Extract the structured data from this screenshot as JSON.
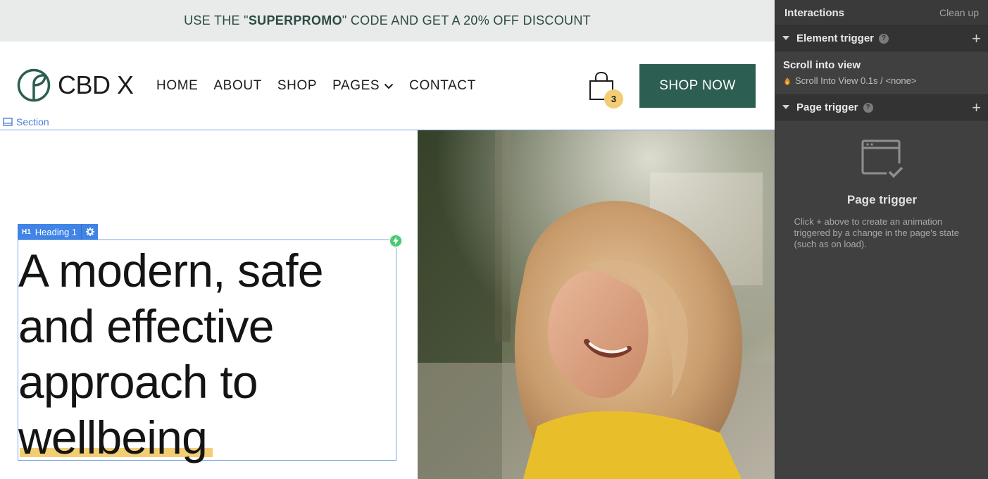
{
  "promo": {
    "prefix": "USE THE \"",
    "code": "SUPERPROMO",
    "suffix": "\" CODE AND GET A 20% OFF DISCOUNT"
  },
  "brand": {
    "name": "CBD X"
  },
  "nav": {
    "home": "HOME",
    "about": "ABOUT",
    "shop": "SHOP",
    "pages": "PAGES",
    "contact": "CONTACT"
  },
  "cart": {
    "count": "3"
  },
  "cta": {
    "label": "SHOP NOW"
  },
  "designer": {
    "section_label": "Section",
    "heading_tag": "Heading 1",
    "heading_tag_prefix": "H1"
  },
  "hero": {
    "line1": "A modern, safe",
    "line2": "and effective",
    "line3": "approach to",
    "line4": "wellbeing"
  },
  "panel": {
    "title": "Interactions",
    "cleanup": "Clean up",
    "element_trigger": "Element trigger",
    "scroll_title": "Scroll into view",
    "scroll_sub": "Scroll Into View 0.1s / <none>",
    "page_trigger": "Page trigger",
    "empty_title": "Page trigger",
    "empty_desc": "Click + above to create an animation triggered by a change in the page's state (such as on load)."
  },
  "colors": {
    "brand_green": "#2d5e52",
    "accent_yellow": "#f2cd74",
    "selection_blue": "#3f84e6",
    "panel_bg": "#404040"
  }
}
